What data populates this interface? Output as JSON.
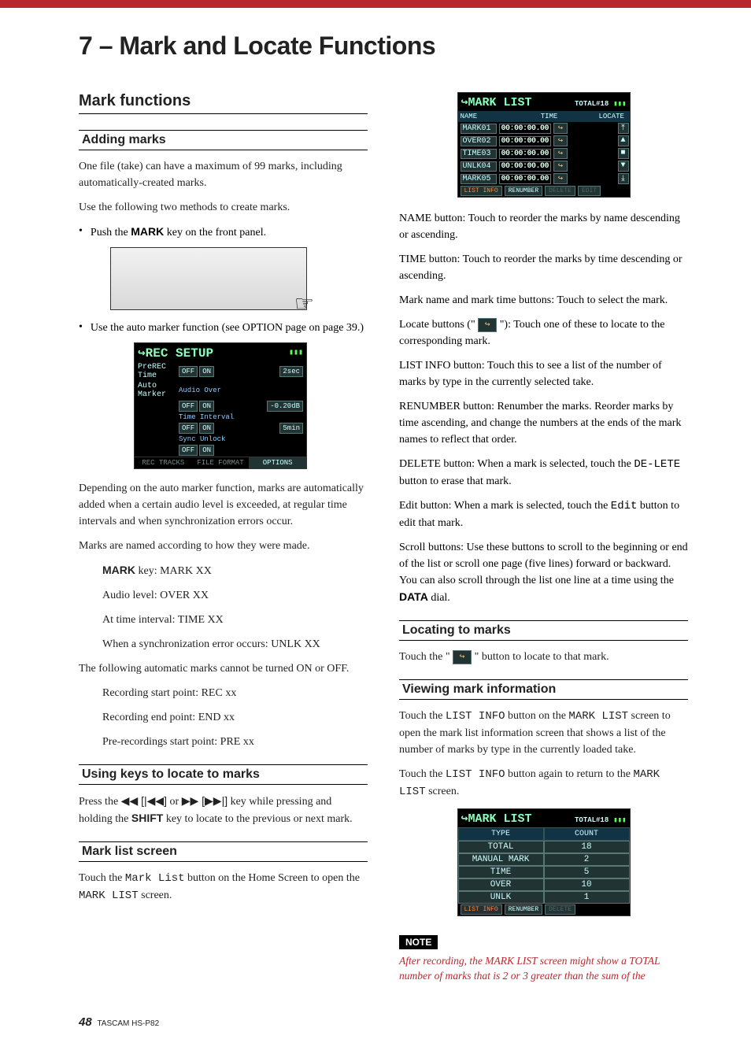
{
  "chapter_title": "7 – Mark and Locate Functions",
  "left": {
    "section_title": "Mark functions",
    "adding_marks": {
      "heading": "Adding marks",
      "p1": "One file (take) can have a maximum of 99 marks, including automatically-created marks.",
      "p2": "Use the following two methods to create marks.",
      "bullet1_prefix": "Push the ",
      "bullet1_key": "MARK",
      "bullet1_suffix": " key on the front panel.",
      "bullet2": "Use the auto marker function (see OPTION page on page 39.)",
      "p3": "Depending on the auto marker function, marks are automatically added when a certain audio level is exceeded, at regular time intervals and when synchronization errors occur.",
      "p4": "Marks are named according to how they were made.",
      "named_key_label": "MARK",
      "named_key_text": " key: MARK XX",
      "named_audio": "Audio level: OVER XX",
      "named_time": "At time interval: TIME XX",
      "named_sync": "When a synchronization error occurs: UNLK XX",
      "p5": "The following automatic marks cannot be turned ON or OFF.",
      "auto_rec": "Recording start point: REC xx",
      "auto_end": "Recording end point: END xx",
      "auto_pre": "Pre-recordings start point: PRE xx"
    },
    "using_keys": {
      "heading": "Using keys to locate to marks",
      "prefix": "Press the ",
      "sym1": "◀◀ [|◀◀]",
      "mid": " or ",
      "sym2": "▶▶ [▶▶|]",
      "t_key": " key while pressing and holding the ",
      "shift": "SHIFT",
      "suffix": " key to locate to the previous or next mark."
    },
    "mark_list_screen": {
      "heading": "Mark list screen",
      "prefix": "Touch the ",
      "btn": "Mark List",
      "mid": " button on the Home Screen to open the ",
      "scr": "MARK LIST",
      "suffix": " screen."
    },
    "rec_setup": {
      "title": "REC SETUP",
      "rows": [
        {
          "label": "PreREC Time",
          "off": "OFF",
          "on": "ON",
          "val": "2sec"
        },
        {
          "label": "Auto Marker",
          "sub": "Audio Over",
          "off": "OFF",
          "on": "ON",
          "val": "-0.20dB"
        },
        {
          "label": "",
          "sub": "Time Interval",
          "off": "OFF",
          "on": "ON",
          "val": "5min"
        },
        {
          "label": "",
          "sub": "Sync Unlock",
          "off": "OFF",
          "on": "ON",
          "val": ""
        }
      ],
      "tabs": [
        "REC TRACKS",
        "FILE FORMAT",
        "OPTIONS"
      ]
    }
  },
  "right": {
    "marklist": {
      "title": "MARK LIST",
      "total": "TOTAL#18",
      "cols": {
        "name": "NAME",
        "time": "TIME",
        "locate": "LOCATE"
      },
      "rows": [
        {
          "name": "MARK01",
          "time": "00:00:00.00"
        },
        {
          "name": "OVER02",
          "time": "00:00:00.00"
        },
        {
          "name": "TIME03",
          "time": "00:00:00.00"
        },
        {
          "name": "UNLK04",
          "time": "00:00:00.00"
        },
        {
          "name": "MARK05",
          "time": "00:00:00.00"
        }
      ],
      "footer": {
        "list_info": "LIST INFO",
        "renumber": "RENUMBER",
        "delete": "DELETE",
        "edit": "EDIT"
      }
    },
    "defs": {
      "name": "NAME button: Touch to reorder the marks by name descending or ascending.",
      "time": "TIME button: Touch to reorder the marks by time descending or ascending.",
      "markname": "Mark name and mark time buttons: Touch to select the mark.",
      "locate_prefix": "Locate buttons (\" ",
      "locate_suffix": " \"): Touch one of these to locate to the corresponding mark.",
      "listinfo": "LIST INFO button: Touch this to see a list of the number of marks by type in the currently selected take.",
      "renumber": "RENUMBER button: Renumber the marks. Reorder marks by time ascending, and change the numbers at the ends of the mark names to reflect that order.",
      "delete_prefix": "DELETE button: When a mark is selected, touch the ",
      "delete_btn": "DE-LETE",
      "delete_suffix": " button to erase that mark.",
      "edit_prefix": "Edit button: When a mark is selected, touch the ",
      "edit_btn": "Edit",
      "edit_suffix": " button to edit that mark.",
      "scroll_prefix": "Scroll buttons: Use these buttons to scroll to the beginning or end of the list or scroll one page (five lines) forward or backward. You can also scroll through the list one line at a time using the ",
      "scroll_key": "DATA",
      "scroll_suffix": " dial."
    },
    "locating": {
      "heading": "Locating to marks",
      "prefix": "Touch the \" ",
      "suffix": " \" button to locate to that mark."
    },
    "viewing": {
      "heading": "Viewing mark information",
      "p1_prefix": "Touch the ",
      "listinfo": "LIST INFO",
      "p1_mid": " button on the ",
      "marklist": "MARK LIST",
      "p1_suffix": " screen to open the mark list information screen that shows a list of the number of marks by type in the currently loaded take.",
      "p2_prefix": "Touch the ",
      "p2_mid": " button again to return to the ",
      "p2_suffix": " screen."
    },
    "info_table": {
      "title": "MARK LIST",
      "total": "TOTAL#18",
      "headers": {
        "type": "TYPE",
        "count": "COUNT"
      },
      "rows": [
        {
          "type": "TOTAL",
          "count": "18"
        },
        {
          "type": "MANUAL MARK",
          "count": "2"
        },
        {
          "type": "TIME",
          "count": "5"
        },
        {
          "type": "OVER",
          "count": "10"
        },
        {
          "type": "UNLK",
          "count": "1"
        }
      ],
      "footer": {
        "list_info": "LIST INFO",
        "renumber": "RENUMBER",
        "delete": "DELETE"
      }
    },
    "note": {
      "badge": "NOTE",
      "text": "After recording, the MARK LIST screen might show a TOTAL number of marks that is 2 or 3 greater than the sum of the"
    }
  },
  "footer": {
    "page": "48",
    "model": "TASCAM  HS-P82"
  }
}
